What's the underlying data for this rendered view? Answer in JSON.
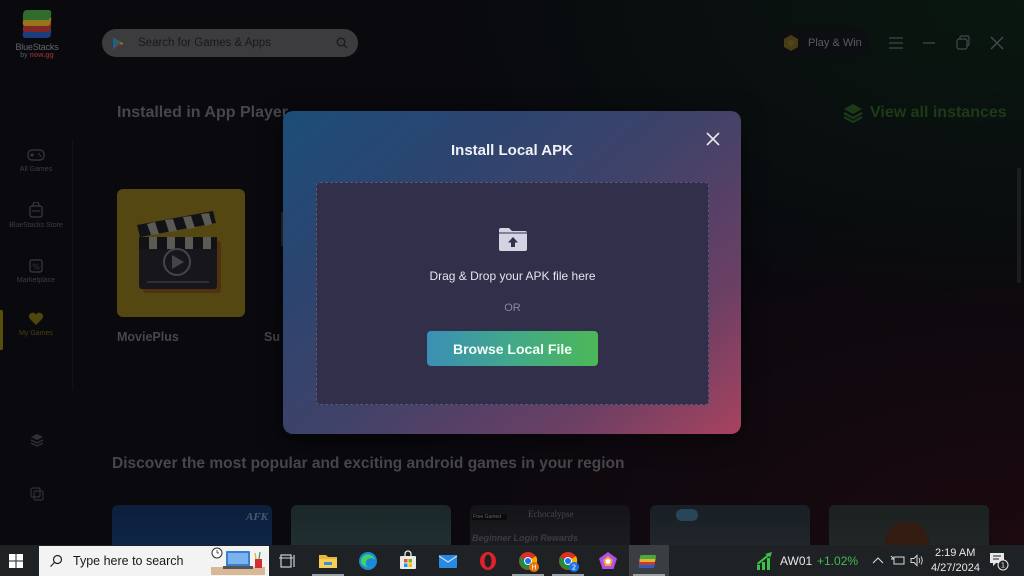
{
  "app": {
    "brand": {
      "name": "BlueStacks",
      "by": "by",
      "company": "now.gg"
    },
    "search": {
      "placeholder": "Search for Games & Apps"
    },
    "play_win_label": "Play & Win",
    "window_controls": [
      "menu-icon",
      "minimize-icon",
      "restore-icon",
      "close-icon"
    ]
  },
  "sidebar": {
    "items": [
      {
        "label": "All Games",
        "icon": "gamepad-icon",
        "active": false
      },
      {
        "label": "BlueStacks Store",
        "icon": "store-bag-icon",
        "active": false
      },
      {
        "label": "Marketplace",
        "icon": "percent-bag-icon",
        "active": false
      },
      {
        "label": "My Games",
        "icon": "heart-icon",
        "active": true
      }
    ],
    "bottom_icons": [
      "layers-icon",
      "multi-instance-icon"
    ]
  },
  "main": {
    "installed_title": "Installed in App Player",
    "view_all_label": "View all instances",
    "installed_apps": [
      {
        "name": "MoviePlus"
      },
      {
        "name": "Su"
      }
    ],
    "discover_title": "Discover the most popular and exciting android games in your region",
    "discover_thumbs": [
      {
        "caption": "AFK"
      },
      {
        "caption": ""
      },
      {
        "caption": "Echocalypse",
        "badge": "Free Gamed",
        "subtitle": "Beginner Login Rewards"
      },
      {
        "caption": ""
      },
      {
        "caption": ""
      }
    ]
  },
  "modal": {
    "title": "Install Local APK",
    "drop_text": "Drag & Drop your APK file here",
    "or_text": "OR",
    "browse_label": "Browse Local File"
  },
  "taskbar": {
    "search_placeholder": "Type here to search",
    "pinned": [
      "task-view",
      "file-explorer",
      "edge",
      "microsoft-store",
      "mail",
      "opera",
      "chrome-profile-h",
      "chrome-profile-2",
      "app-pentagon",
      "bluestacks"
    ],
    "chrome_badges": [
      "H",
      "2"
    ],
    "stock": {
      "ticker": "AW01",
      "change": "+1.02%",
      "color": "#3fbf4a"
    },
    "time": "2:19 AM",
    "date": "4/27/2024",
    "notification_count": "1"
  }
}
